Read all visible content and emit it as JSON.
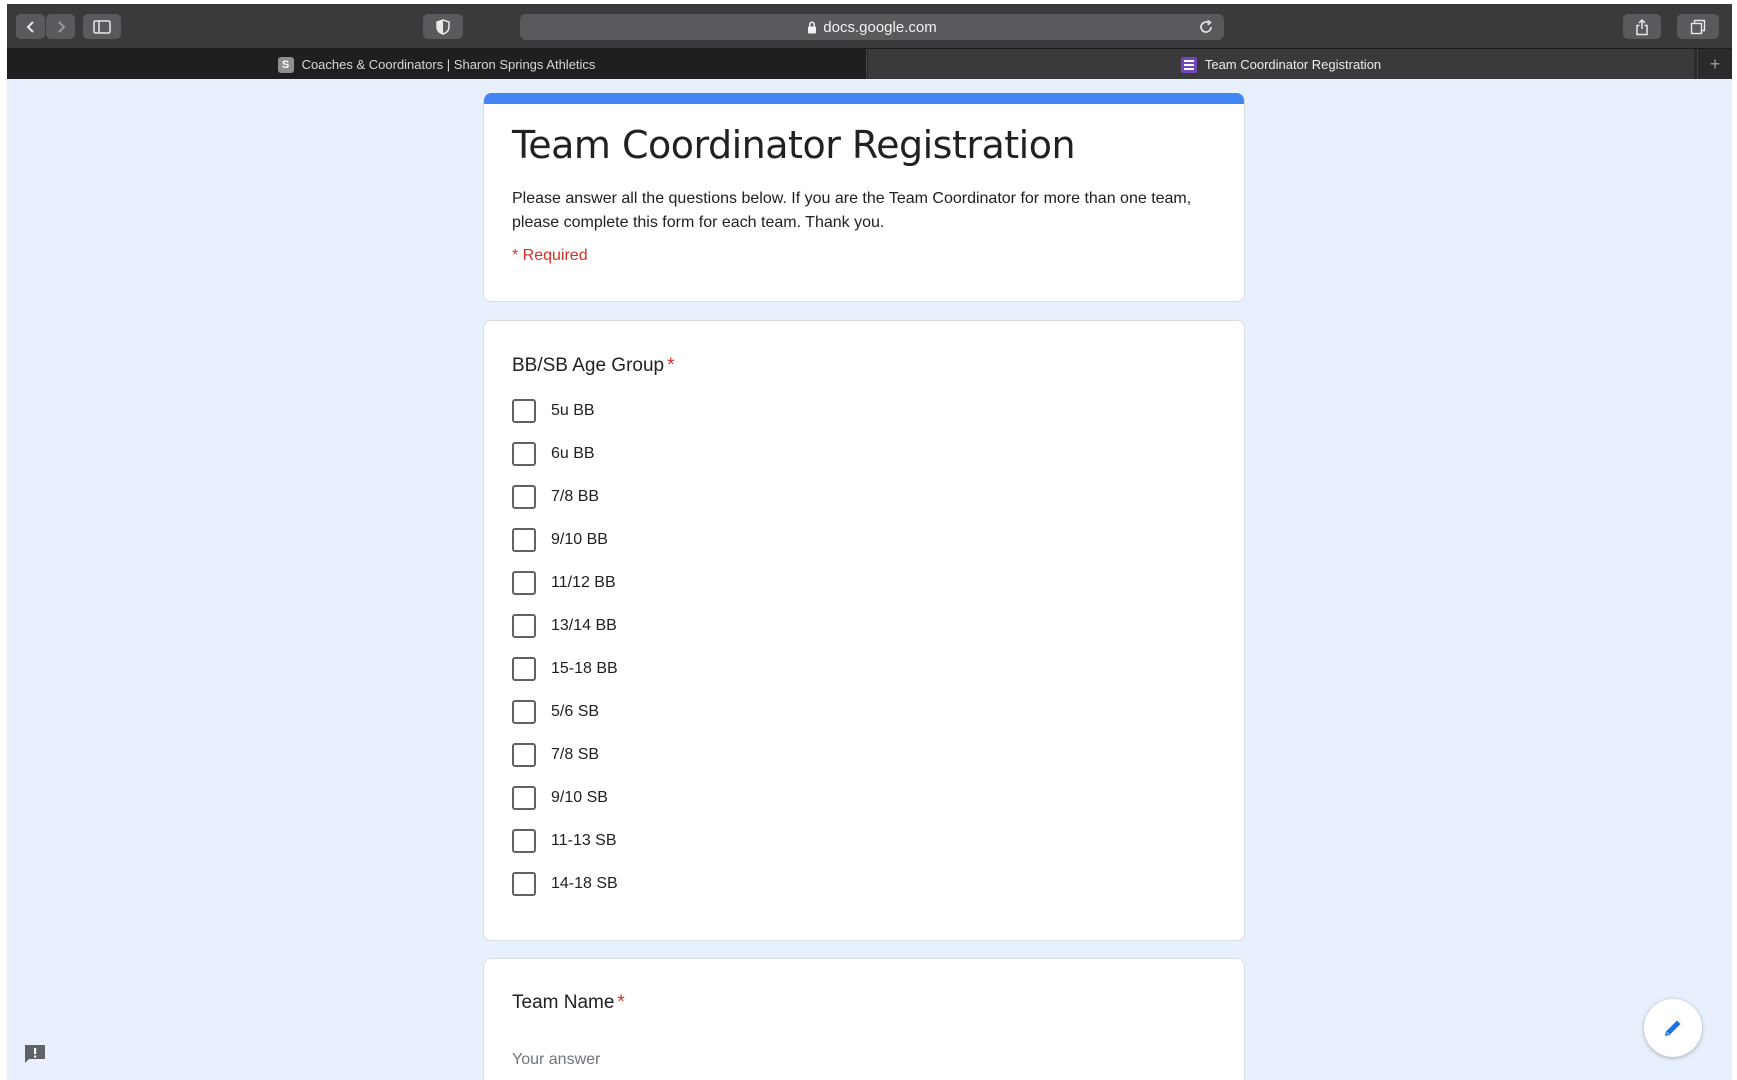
{
  "browser": {
    "url": "docs.google.com",
    "tabs": [
      {
        "favicon_letter": "S",
        "label": "Coaches & Coordinators | Sharon Springs Athletics"
      },
      {
        "label": "Team Coordinator Registration"
      }
    ],
    "add_tab_label": "+"
  },
  "form": {
    "title": "Team Coordinator Registration",
    "description": "Please answer all the questions below. If you are the Team Coordinator for more than one team, please complete this form for each team. Thank you.",
    "required_note": "* Required",
    "questions": [
      {
        "title": "BB/SB Age Group",
        "required_star": "*",
        "type": "checkbox",
        "options": [
          "5u BB",
          "6u BB",
          "7/8 BB",
          "9/10 BB",
          "11/12 BB",
          "13/14 BB",
          "15-18 BB",
          "5/6 SB",
          "7/8 SB",
          "9/10 SB",
          "11-13 SB",
          "14-18 SB"
        ]
      },
      {
        "title": "Team Name",
        "required_star": "*",
        "type": "short-answer",
        "placeholder": "Your answer"
      }
    ]
  },
  "colors": {
    "accent": "#4285f4",
    "required": "#d93025",
    "page_bg": "#e8f0fe"
  }
}
